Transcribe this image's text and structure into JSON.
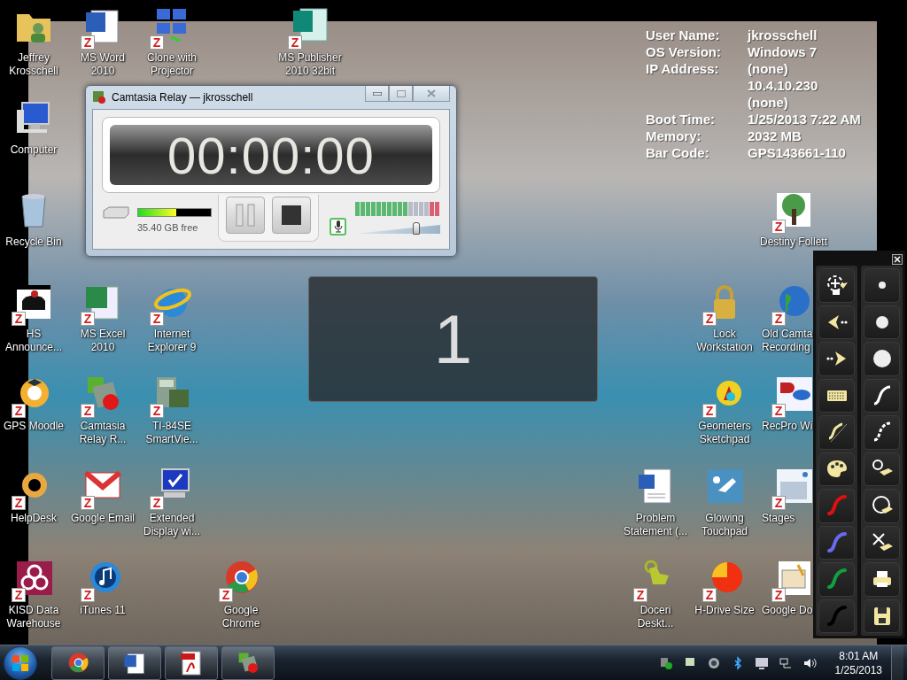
{
  "desktop_icons": [
    {
      "label": "Jeffrey Krosschell"
    },
    {
      "label": "MS Word 2010",
      "badge": "Z"
    },
    {
      "label": "Clone with Projector",
      "badge": "Z"
    },
    {
      "label": "MS Publisher 2010 32bit",
      "badge": "Z"
    },
    {
      "label": "Computer"
    },
    {
      "label": "Recycle Bin"
    },
    {
      "label": "Destiny Follett",
      "badge": "Z"
    },
    {
      "label": "HS Announce...",
      "badge": "Z"
    },
    {
      "label": "MS Excel 2010",
      "badge": "Z"
    },
    {
      "label": "Internet Explorer 9",
      "badge": "Z"
    },
    {
      "label": "Lock Workstation",
      "badge": "Z"
    },
    {
      "label": "Old Camta Recording",
      "badge": "Z"
    },
    {
      "label": "GPS Moodle",
      "badge": "Z"
    },
    {
      "label": "Camtasia Relay R...",
      "badge": "Z"
    },
    {
      "label": "TI-84SE SmartVie...",
      "badge": "Z"
    },
    {
      "label": "Geometers Sketchpad",
      "badge": "Z"
    },
    {
      "label": "RecPro Wi",
      "badge": "Z"
    },
    {
      "label": "HelpDesk",
      "badge": "Z"
    },
    {
      "label": "Google Email",
      "badge": "Z"
    },
    {
      "label": "Extended Display wi...",
      "badge": "Z"
    },
    {
      "label": "Problem Statement (..."
    },
    {
      "label": "Glowing Touchpad"
    },
    {
      "label": "Stages",
      "badge": "Z"
    },
    {
      "label": "KISD Data Warehouse",
      "badge": "Z"
    },
    {
      "label": "iTunes 11",
      "badge": "Z"
    },
    {
      "label": "Google Chrome",
      "badge": "Z"
    },
    {
      "label": "Doceri Deskt...",
      "badge": "Z"
    },
    {
      "label": "H-Drive Size",
      "badge": "Z"
    },
    {
      "label": "Google Do",
      "badge": "Z"
    }
  ],
  "system_info": [
    {
      "label": "User Name:",
      "values": [
        "jkrosschell"
      ]
    },
    {
      "label": "OS Version:",
      "values": [
        "Windows 7"
      ]
    },
    {
      "label": "IP Address:",
      "values": [
        "(none)",
        "10.4.10.230",
        "(none)"
      ]
    },
    {
      "label": "Boot Time:",
      "values": [
        "1/25/2013 7:22 AM"
      ]
    },
    {
      "label": "Memory:",
      "values": [
        "2032 MB"
      ]
    },
    {
      "label": "Bar Code:",
      "values": [
        "GPS143661-110"
      ]
    }
  ],
  "recorder_window": {
    "title": "Camtasia Relay — jkrosschell",
    "timer": "00:00:00",
    "disk": {
      "level": 0.52,
      "text": "35.40 GB free"
    },
    "audio_meter": {
      "level": 0.625
    },
    "volume": {
      "level": 0.72
    }
  },
  "countdown": {
    "number": "1"
  },
  "pen_toolbar": {
    "pens": [
      {
        "color": "#e01010"
      },
      {
        "color": "#6a6af0"
      },
      {
        "color": "#10a040"
      },
      {
        "color": "#000000"
      }
    ]
  },
  "taskbar": {
    "time": "8:01 AM",
    "date": "1/25/2013"
  }
}
